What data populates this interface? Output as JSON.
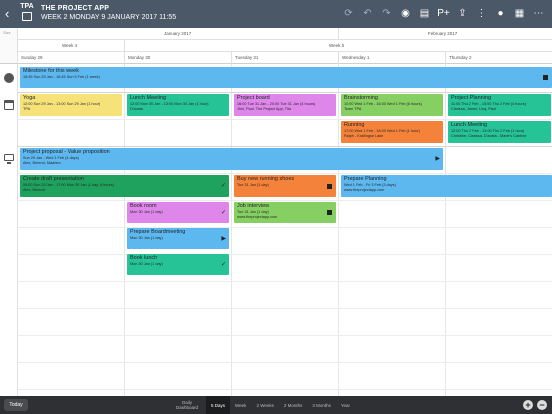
{
  "header": {
    "logo_text": "TPA",
    "title": "THE PROJECT APP",
    "subtitle": "WEEK 2  MONDAY 9 JANUARY 2017  11:55",
    "back": "‹",
    "tools": [
      "⟳",
      "↶",
      "↷",
      "◉",
      "▤",
      "P+",
      "⇪",
      "⋮",
      "●",
      "▦",
      "⋯"
    ]
  },
  "timeline": {
    "corner_label": "Size",
    "months": [
      "January 2017",
      "February 2017"
    ],
    "weeks": [
      "Week 4",
      "Week 5"
    ],
    "days": [
      "Sunday 29",
      "Monday 30",
      "Tuesday 31",
      "Wednesday 1",
      "Thursday 2"
    ]
  },
  "tasks": {
    "milestone": {
      "title": "Milestone for this week",
      "dates": "16:45 Sun 29 Jan - 16:45 Sun 5 Feb (1 week)"
    },
    "yoga": {
      "title": "Yoga",
      "dates": "12:00 Sun 29 Jan - 13:00 Sun 29 Jan (1 hour)",
      "people": "TPA"
    },
    "lunch1": {
      "title": "Lunch Meeting",
      "dates": "12:00 Mon 30 Jan - 13:00 Mon 30 Jan (1 hour)",
      "people": "D'aosta"
    },
    "board": {
      "title": "Project board",
      "dates": "16:00 Tue 31 Jan - 20:00 Tue 31 Jan (4 hours)",
      "people": "Jhni, Paul, The Project App, Tita"
    },
    "brainstorm": {
      "title": "Brainstorming",
      "dates": "10:00 Wed 1 Feb - 16:00 Wed 1 Feb (6 hours)",
      "people": "Team TPA"
    },
    "planning1": {
      "title": "Project Planning",
      "dates": "11:00 Thu 2 Feb - 15:00 Thu 2 Feb (4 hours)",
      "people": "Clarissa, Jamel, Linq, Paul"
    },
    "running": {
      "title": "Running",
      "dates": "17:00 Wed 1 Feb - 18:00 Wed 1 Feb (1 hour)",
      "people": "Ralph - Krallingse Lake"
    },
    "lunch2": {
      "title": "Lunch Meeting",
      "dates": "12:00 Thu 2 Feb - 13:00 Thu 2 Feb (1 hour)",
      "people": "Christine, Clarissa, D'aosta - Marie's Cantine"
    },
    "proposal": {
      "title": "Project proposal - Value proposition",
      "dates": "Sun 29 Jan - Wed 1 Feb (4 days)",
      "people": "Alex, Berend, Maarten"
    },
    "draft": {
      "title": "Create draft presentation",
      "dates": "09:00 Sun 29 Jan - 17:00 Mon 30 Jan (1 day, 8 hours)",
      "people": "Alex, Berend"
    },
    "shoes": {
      "title": "Buy new running shoes",
      "dates": "Tue 31 Jan (1 day)"
    },
    "prep_planning": {
      "title": "Prepare Planning",
      "dates": "Wed 1 Feb - Fri 3 Feb (3 days)",
      "people": "www.theprojectapp.com"
    },
    "bookroom": {
      "title": "Book room",
      "dates": "Mon 30 Jan (1 day)"
    },
    "interview": {
      "title": "Job interview",
      "dates": "Tue 31 Jan (1 day)",
      "people": "www.theprojectapp.com"
    },
    "boardmeeting": {
      "title": "Prepare Boardmeeting",
      "dates": "Mon 30 Jan (1 day)"
    },
    "booklunch": {
      "title": "Book lunch",
      "dates": "Mon 30 Jan (1 day)"
    }
  },
  "footer": {
    "today": "Today",
    "tabs": [
      "Daily Dashboard",
      "5 Days",
      "Week",
      "2 Weeks",
      "2 Months",
      "3 Months",
      "Year"
    ],
    "active_tab": "5 Days",
    "plus": "+",
    "minus": "−"
  },
  "colors": {
    "blue": "#5db8f0",
    "green": "#26c397",
    "yellow": "#f7e27a",
    "pink": "#de86ea",
    "lime": "#86cf63",
    "orange": "#f4823b",
    "dark_green": "#20a25f",
    "topbar": "#4a5868"
  }
}
